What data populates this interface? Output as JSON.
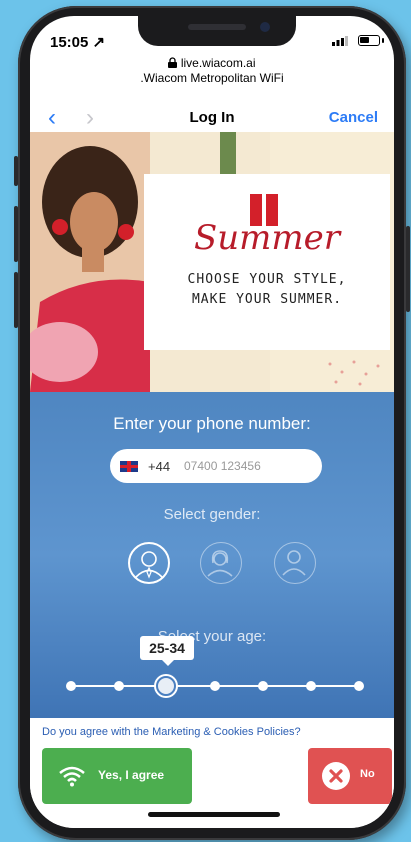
{
  "status": {
    "time": "15:05 ↗"
  },
  "browser": {
    "domain": "live.wiacom.ai",
    "network": ".Wiacom Metropolitan WiFi",
    "back_icon": "chevron-left-icon",
    "forward_icon": "chevron-right-icon",
    "title": "Log In",
    "cancel": "Cancel"
  },
  "banner": {
    "script_title": "Summer",
    "tagline_line1": "Choose your style,",
    "tagline_line2": "make your summer.",
    "accent_color": "#d3202a"
  },
  "form": {
    "phone_label": "Enter your phone number:",
    "country_code": "+44",
    "phone_placeholder": "07400 123456",
    "gender_label": "Select gender:",
    "genders": [
      "male-icon",
      "female-icon",
      "neutral-icon"
    ],
    "age_label": "Select your age:",
    "age_value": "25-34",
    "age_steps": 7,
    "age_selected_index": 2
  },
  "consent": {
    "question": "Do you agree with the Marketing & Cookies Policies?",
    "yes_label": "Yes, I agree",
    "no_label": "No",
    "yes_color": "#4cae4f",
    "no_color": "#e05252"
  }
}
